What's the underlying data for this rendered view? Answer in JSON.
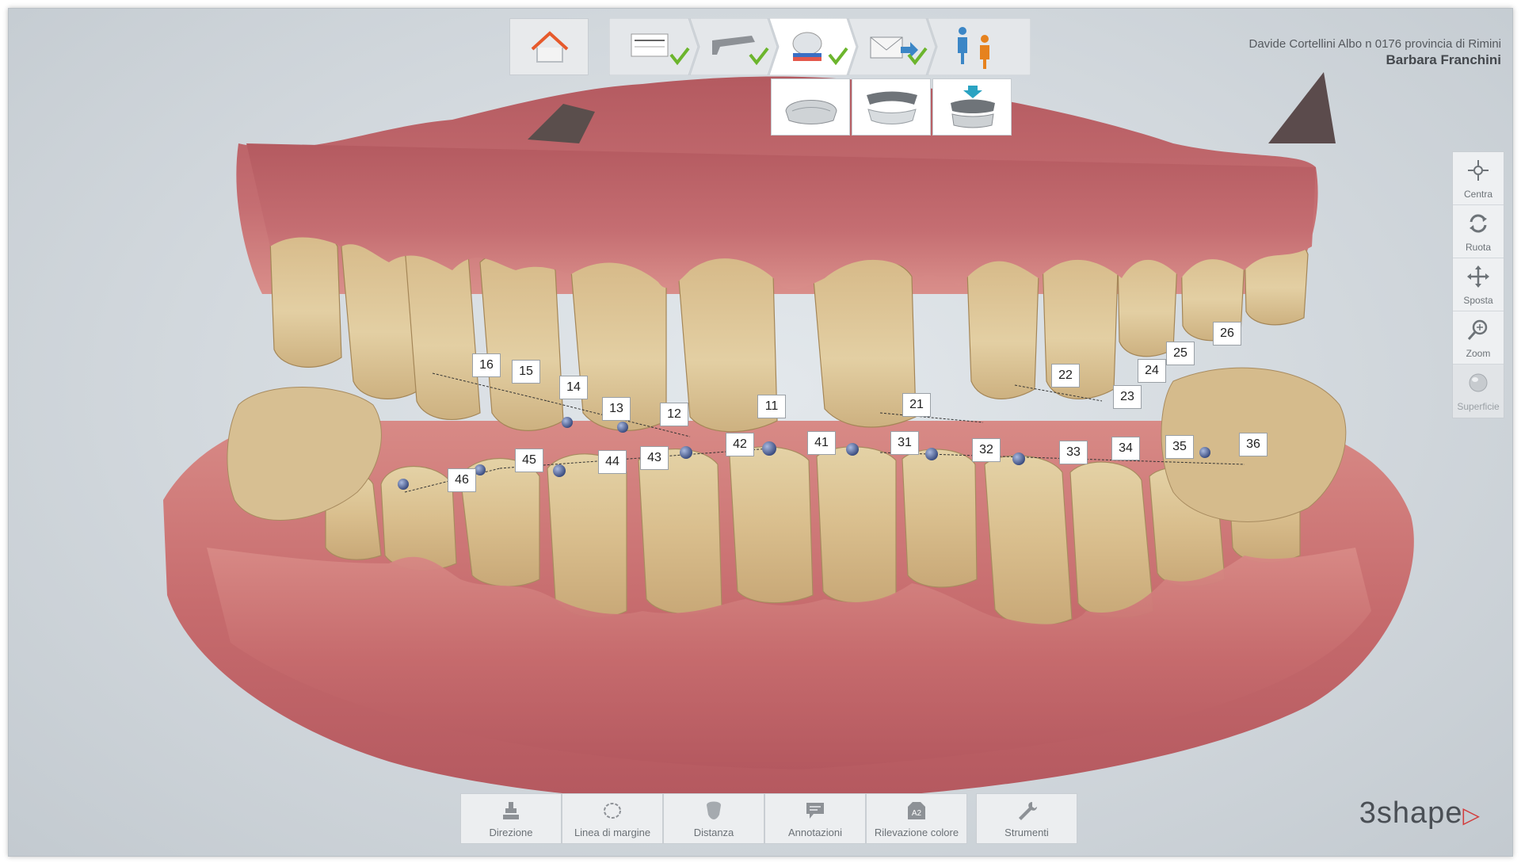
{
  "patient": {
    "doctor_line": "Davide Cortellini Albo n 0176 provincia di Rimini",
    "patient_name": "Barbara Franchini"
  },
  "workflow": {
    "home_icon": "home-icon",
    "steps": [
      {
        "icon": "order-form-icon",
        "done": true
      },
      {
        "icon": "scanner-wand-icon",
        "done": true
      },
      {
        "icon": "color-scan-icon",
        "done": true,
        "active": true
      },
      {
        "icon": "send-icon",
        "done": true
      },
      {
        "icon": "patient-doctor-icon",
        "done": false
      }
    ],
    "substeps": [
      {
        "icon": "upper-jaw-icon"
      },
      {
        "icon": "lower-jaw-icon"
      },
      {
        "icon": "bite-icon"
      }
    ],
    "check_color": "#6cb52d",
    "accent": "#e65a2c"
  },
  "view_tools": [
    {
      "label": "Centra",
      "icon": "center-icon"
    },
    {
      "label": "Ruota",
      "icon": "rotate-icon"
    },
    {
      "label": "Sposta",
      "icon": "move-icon"
    },
    {
      "label": "Zoom",
      "icon": "zoom-icon"
    },
    {
      "label": "Superficie",
      "icon": "surface-icon"
    }
  ],
  "bottom_tools": [
    {
      "label": "Direzione",
      "icon": "direction-icon"
    },
    {
      "label": "Linea di margine",
      "icon": "margin-line-icon"
    },
    {
      "label": "Distanza",
      "icon": "distance-icon"
    },
    {
      "label": "Annotazioni",
      "icon": "annotation-icon"
    },
    {
      "label": "Rilevazione colore",
      "icon": "shade-detect-icon",
      "badge": "A2"
    },
    {
      "label": "Strumenti",
      "icon": "tools-icon"
    }
  ],
  "teeth": [
    "16",
    "15",
    "14",
    "13",
    "12",
    "11",
    "21",
    "22",
    "23",
    "24",
    "25",
    "26",
    "46",
    "45",
    "44",
    "43",
    "42",
    "41",
    "31",
    "32",
    "33",
    "34",
    "35",
    "36"
  ],
  "logo": {
    "text": "3shape"
  }
}
